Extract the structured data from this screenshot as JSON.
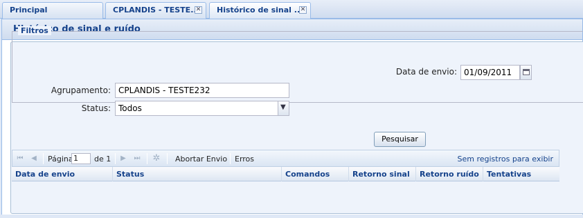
{
  "tabs": [
    {
      "label": "Principal"
    },
    {
      "label": "CPLANDIS - TESTE..."
    },
    {
      "label": "Histórico de sinal ..."
    }
  ],
  "panel": {
    "title": "Histórico de sinal e ruído"
  },
  "filters": {
    "legend": "Filtros",
    "date_label": "Data de envio:",
    "date_value": "01/09/2011",
    "grouping_label": "Agrupamento:",
    "grouping_value": "CPLANDIS - TESTE232",
    "status_label": "Status:",
    "status_value": "Todos"
  },
  "search_button": "Pesquisar",
  "toolbar": {
    "page_label": "Página",
    "page_value": "1",
    "of_label": "de 1",
    "abort_label": "Abortar Envio",
    "errors_label": "Erros",
    "empty_msg": "Sem registros para exibir"
  },
  "grid": {
    "columns": [
      "Data de envio",
      "Status",
      "Comandos",
      "Retorno sinal",
      "Retorno ruído",
      "Tentativas"
    ]
  }
}
